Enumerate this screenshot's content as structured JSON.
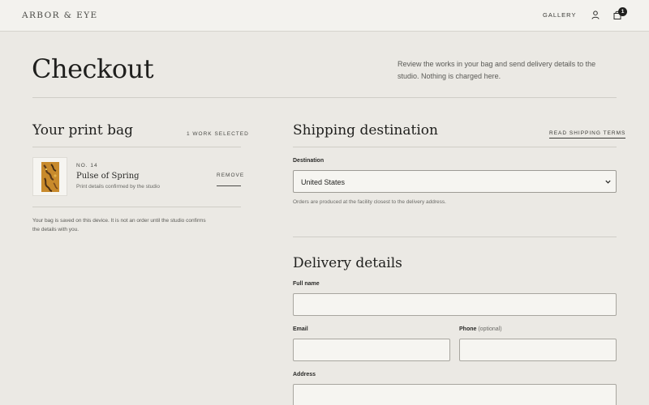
{
  "header": {
    "brand": "ARBOR & EYE",
    "nav_gallery": "GALLERY",
    "bag_count": "1",
    "icons": [
      "user-icon",
      "shopping-bag-icon"
    ]
  },
  "page": {
    "title": "Checkout",
    "intro": "Review the works in your bag and send delivery details to the studio. Nothing is charged here."
  },
  "bag": {
    "title": "Your print bag",
    "count_label": "1 WORK SELECTED",
    "items": [
      {
        "number": "NO. 14",
        "title": "Pulse of Spring",
        "subtitle": "Print details confirmed by the studio",
        "remove_label": "REMOVE"
      }
    ],
    "note": "Your bag is saved on this device. It is not an order until the studio confirms the details with you."
  },
  "shipping": {
    "title": "Shipping destination",
    "terms_link": "READ SHIPPING TERMS",
    "destination_label": "Destination",
    "destination_value": "United States",
    "destination_note": "Orders are produced at the facility closest to the delivery address."
  },
  "delivery": {
    "title": "Delivery details",
    "full_name_label": "Full name",
    "full_name_value": "",
    "email_label": "Email",
    "email_value": "",
    "phone_label": "Phone",
    "phone_optional": "(optional)",
    "phone_value": "",
    "address_label": "Address",
    "address_value": ""
  },
  "colors": {
    "background": "#ebe9e4",
    "header_bg": "#f3f2ee",
    "input_bg": "#f6f5f1",
    "text": "#1f1f1d",
    "artwork_accent": "#c88a2c"
  }
}
